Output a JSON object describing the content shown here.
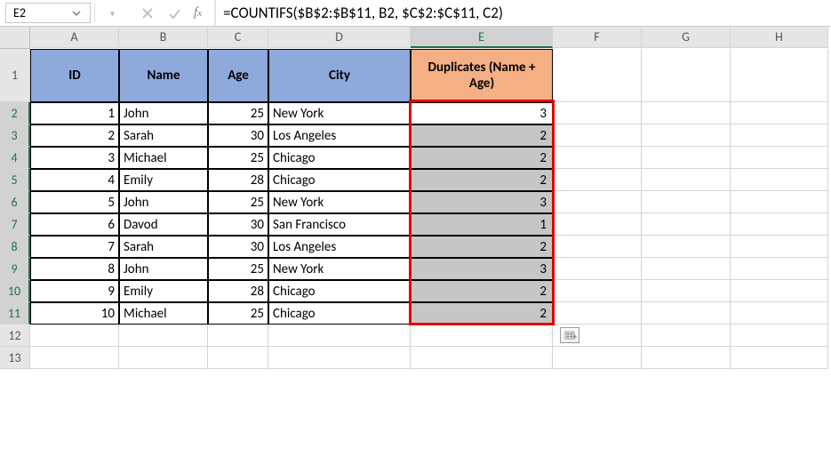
{
  "namebox": "E2",
  "formula": "=COUNTIFS($B$2:$B$11, B2, $C$2:$C$11, C2)",
  "columns": [
    "A",
    "B",
    "C",
    "D",
    "E",
    "F",
    "G",
    "H"
  ],
  "row_numbers": [
    "1",
    "2",
    "3",
    "4",
    "5",
    "6",
    "7",
    "8",
    "9",
    "10",
    "11",
    "12",
    "13"
  ],
  "headers": {
    "id": "ID",
    "name": "Name",
    "age": "Age",
    "city": "City",
    "dup": "Duplicates (Name + Age)"
  },
  "rows": [
    {
      "id": "1",
      "name": "John",
      "age": "25",
      "city": "New York",
      "dup": "3"
    },
    {
      "id": "2",
      "name": "Sarah",
      "age": "30",
      "city": "Los Angeles",
      "dup": "2"
    },
    {
      "id": "3",
      "name": "Michael",
      "age": "25",
      "city": "Chicago",
      "dup": "2"
    },
    {
      "id": "4",
      "name": "Emily",
      "age": "28",
      "city": "Chicago",
      "dup": "2"
    },
    {
      "id": "5",
      "name": "John",
      "age": "25",
      "city": "New York",
      "dup": "3"
    },
    {
      "id": "6",
      "name": "Davod",
      "age": "30",
      "city": "San Francisco",
      "dup": "1"
    },
    {
      "id": "7",
      "name": "Sarah",
      "age": "30",
      "city": "Los Angeles",
      "dup": "2"
    },
    {
      "id": "8",
      "name": "John",
      "age": "25",
      "city": "New York",
      "dup": "3"
    },
    {
      "id": "9",
      "name": "Emily",
      "age": "28",
      "city": "Chicago",
      "dup": "2"
    },
    {
      "id": "10",
      "name": "Michael",
      "age": "25",
      "city": "Chicago",
      "dup": "2"
    }
  ],
  "selected_column": "E",
  "selected_rows_start": 2,
  "selected_rows_end": 11,
  "active_cell": "E2"
}
